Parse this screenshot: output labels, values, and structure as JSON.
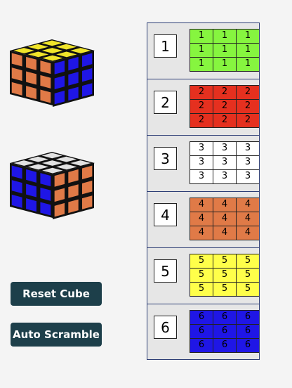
{
  "cubes": {
    "front_view": {
      "top_color": "#f0e42a",
      "left_color": "#e07a47",
      "right_color": "#1f16e6"
    },
    "back_view": {
      "top_color": "#e2e2e2",
      "left_color": "#1f16e6",
      "right_color": "#e07a47"
    }
  },
  "buttons": {
    "reset_label": "Reset Cube",
    "scramble_label": "Auto Scramble"
  },
  "faces": [
    {
      "number": "1",
      "color": "#86f53f",
      "cells": [
        "1",
        "1",
        "1",
        "1",
        "1",
        "1",
        "1",
        "1",
        "1"
      ]
    },
    {
      "number": "2",
      "color": "#e5301f",
      "cells": [
        "2",
        "2",
        "2",
        "2",
        "2",
        "2",
        "2",
        "2",
        "2"
      ]
    },
    {
      "number": "3",
      "color": "#ffffff",
      "cells": [
        "3",
        "3",
        "3",
        "3",
        "3",
        "3",
        "3",
        "3",
        "3"
      ]
    },
    {
      "number": "4",
      "color": "#e07a47",
      "cells": [
        "4",
        "4",
        "4",
        "4",
        "4",
        "4",
        "4",
        "4",
        "4"
      ]
    },
    {
      "number": "5",
      "color": "#ffff4a",
      "cells": [
        "5",
        "5",
        "5",
        "5",
        "5",
        "5",
        "5",
        "5",
        "5"
      ]
    },
    {
      "number": "6",
      "color": "#1f16e6",
      "cells": [
        "6",
        "6",
        "6",
        "6",
        "6",
        "6",
        "6",
        "6",
        "6"
      ]
    }
  ]
}
